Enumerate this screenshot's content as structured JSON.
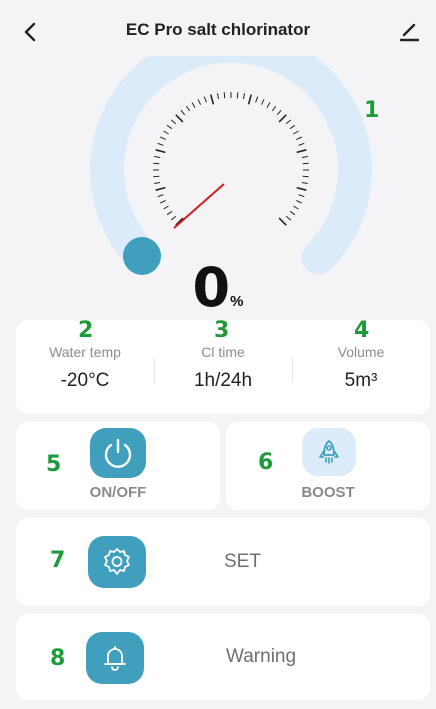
{
  "header": {
    "title": "EC Pro salt chlorinator"
  },
  "gauge": {
    "value": 0,
    "unit": "%",
    "marker_num": "1"
  },
  "stats": [
    {
      "num": "2",
      "label": "Water temp",
      "value": "-20°C"
    },
    {
      "num": "3",
      "label": "Cl time",
      "value": "1h/24h"
    },
    {
      "num": "4",
      "label": "Volume",
      "value": "5m³"
    }
  ],
  "controls": {
    "onoff": {
      "num": "5",
      "label": "ON/OFF"
    },
    "boost": {
      "num": "6",
      "label": "BOOST"
    },
    "set": {
      "num": "7",
      "label": "SET"
    },
    "warning": {
      "num": "8",
      "label": "Warning"
    }
  },
  "colors": {
    "accent": "#3f9fbd",
    "gauge_track": "#dcebfa",
    "needle": "#cc1f1f",
    "marker_green": "#1f9a3a"
  }
}
